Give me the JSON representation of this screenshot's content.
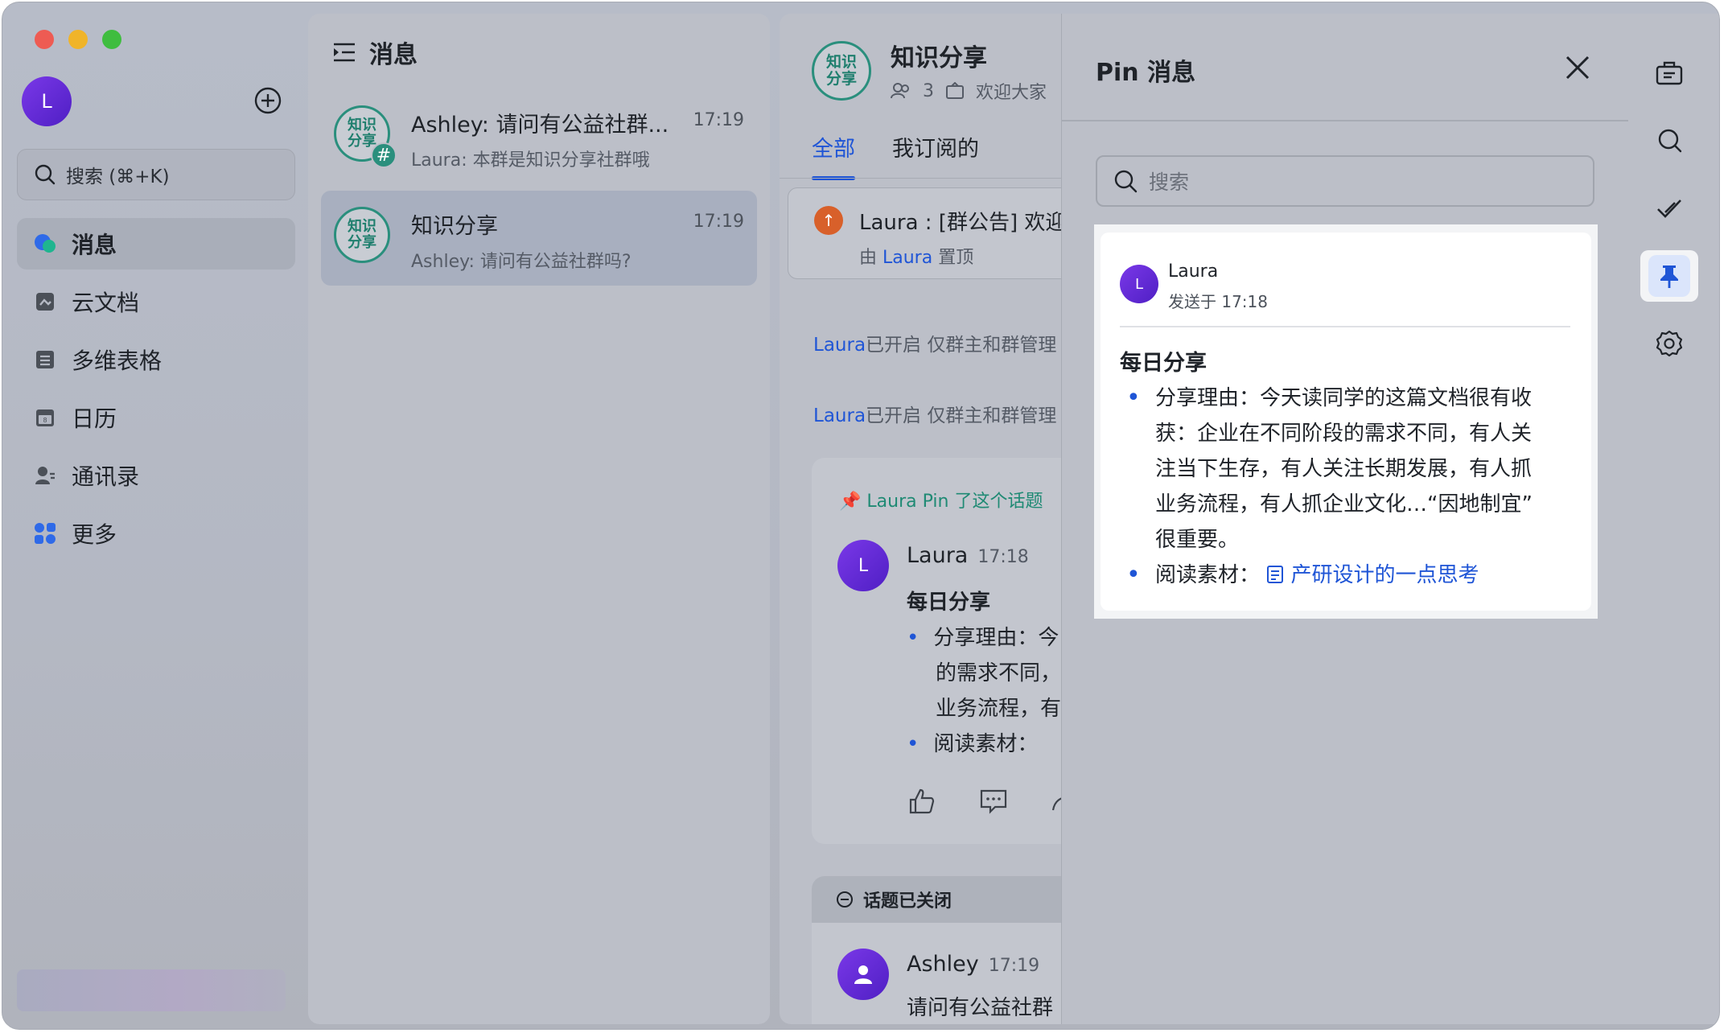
{
  "sidebar": {
    "avatar_initial": "L",
    "search_placeholder": "搜索 (⌘+K)",
    "items": [
      {
        "label": "消息",
        "icon": "chat-bubble-icon"
      },
      {
        "label": "云文档",
        "icon": "cloud-doc-icon"
      },
      {
        "label": "多维表格",
        "icon": "table-icon"
      },
      {
        "label": "日历",
        "icon": "calendar-icon"
      },
      {
        "label": "通讯录",
        "icon": "contacts-icon"
      },
      {
        "label": "更多",
        "icon": "apps-grid-icon"
      }
    ]
  },
  "chat_list": {
    "title": "消息",
    "chats": [
      {
        "avatar_text": "知识分享",
        "name": "Ashley: 请问有公益社群...",
        "time": "17:19",
        "preview": "Laura: 本群是知识分享社群哦"
      },
      {
        "avatar_text": "知识分享",
        "name": "知识分享",
        "time": "17:19",
        "preview": "Ashley: 请问有公益社群吗?"
      }
    ]
  },
  "conversation": {
    "avatar_text": "知识分享",
    "title": "知识分享",
    "member_count": "3",
    "announcement": "欢迎大家",
    "tabs": [
      "全部",
      "我订阅的"
    ],
    "pinned_announce": {
      "text": "Laura : [群公告] 欢迎",
      "by_prefix": "由 ",
      "by_name": "Laura",
      "by_suffix": " 置顶"
    },
    "system_messages": [
      {
        "user": "Laura",
        "text": "已开启 仅群主和群管理"
      },
      {
        "user": "Laura",
        "text": "已开启 仅群主和群管理"
      }
    ],
    "topic": {
      "pin_note": "Laura Pin 了这个话题",
      "sender": "Laura",
      "time": "17:18",
      "title": "每日分享",
      "lines": [
        "分享理由：今",
        "的需求不同，",
        "业务流程，有",
        "阅读素材："
      ]
    },
    "closed_topic": {
      "status": "话题已关闭",
      "sender": "Ashley",
      "time": "17:19",
      "text": "请问有公益社群"
    }
  },
  "pin_panel": {
    "title": "Pin 消息",
    "search_placeholder": "搜索",
    "card": {
      "avatar_initial": "L",
      "sender": "Laura",
      "sent_at": "发送于 17:18",
      "title": "每日分享",
      "reason_lines": [
        "分享理由：今天读同学的这篇文档很有收",
        "获：企业在不同阶段的需求不同，有人关",
        "注当下生存，有人关注长期发展，有人抓",
        "业务流程，有人抓企业文化…“因地制宜”",
        "很重要。"
      ],
      "reading_label": "阅读素材：",
      "reading_link": "产研设计的一点思考"
    }
  },
  "toolbar": {
    "icons": [
      "briefcase-icon",
      "search-icon",
      "check-icon",
      "pin-icon",
      "settings-icon"
    ]
  },
  "colors": {
    "accent": "#1f55d6",
    "teal": "#2a8f7d",
    "avatar_purple": "#6a2fe0"
  }
}
